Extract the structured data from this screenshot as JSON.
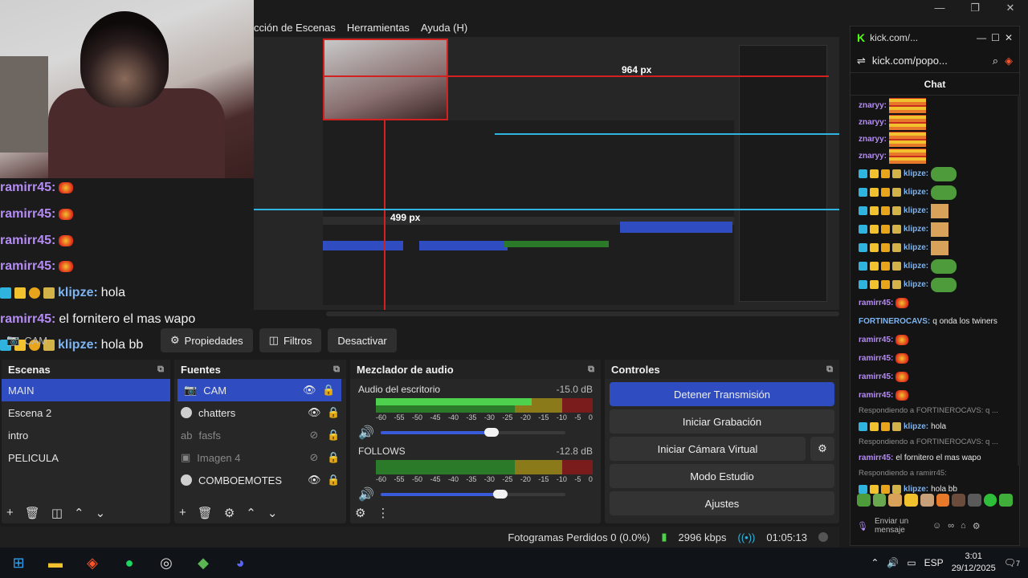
{
  "window": {
    "minimize": "—",
    "maximize": "❐",
    "close": "✕"
  },
  "menu": {
    "items": [
      "cción de Escenas",
      "Herramientas",
      "Ayuda (H)"
    ]
  },
  "preview": {
    "label_964": "964 px",
    "label_499": "499 px"
  },
  "chat_overlay": [
    {
      "user": "ramirr45:",
      "text": "",
      "type": "r"
    },
    {
      "user": "ramirr45:",
      "text": "",
      "type": "r"
    },
    {
      "user": "ramirr45:",
      "text": "",
      "type": "r"
    },
    {
      "user": "ramirr45:",
      "text": "",
      "type": "r"
    },
    {
      "user": "klipze:",
      "text": "hola",
      "type": "k"
    },
    {
      "user": "ramirr45:",
      "text": "el fornitero el mas wapo",
      "type": "r"
    },
    {
      "user": "klipze:",
      "text": "hola bb",
      "type": "k"
    }
  ],
  "toolbar": {
    "source": "CAM",
    "properties": "Propiedades",
    "filters": "Filtros",
    "deactivate": "Desactivar"
  },
  "scenes": {
    "title": "Escenas",
    "items": [
      "MAIN",
      "Escena 2",
      "intro",
      "PELICULA"
    ],
    "selected": 0
  },
  "sources": {
    "title": "Fuentes",
    "items": [
      {
        "name": "CAM",
        "visible": true
      },
      {
        "name": "chatters",
        "visible": true
      },
      {
        "name": "fasfs",
        "visible": false
      },
      {
        "name": "Imagen 4",
        "visible": false
      },
      {
        "name": "COMBOEMOTES",
        "visible": true
      }
    ],
    "selected": 0
  },
  "mixer": {
    "title": "Mezclador de audio",
    "tracks": [
      {
        "name": "Audio del escritorio",
        "db": "-15.0 dB",
        "level": 0.72,
        "volume": 0.6
      },
      {
        "name": "FOLLOWS",
        "db": "-12.8 dB",
        "level": 0.0,
        "volume": 0.65
      }
    ],
    "scale": [
      "-60",
      "-55",
      "-50",
      "-45",
      "-40",
      "-35",
      "-30",
      "-25",
      "-20",
      "-15",
      "-10",
      "-5",
      "0"
    ]
  },
  "controls": {
    "title": "Controles",
    "stop_stream": "Detener Transmisión",
    "start_recording": "Iniciar Grabación",
    "start_virtual_cam": "Iniciar Cámara Virtual",
    "studio_mode": "Modo Estudio",
    "settings": "Ajustes"
  },
  "status": {
    "dropped": "Fotogramas Perdidos 0 (0.0%)",
    "bitrate": "2996 kbps",
    "time": "01:05:13"
  },
  "kick": {
    "tab": "kick.com/...",
    "url": "kick.com/popo...",
    "chat_title": "Chat",
    "messages": [
      {
        "kind": "big",
        "user": "znaryy:",
        "cls": "r"
      },
      {
        "kind": "big",
        "user": "znaryy:",
        "cls": "r"
      },
      {
        "kind": "big",
        "user": "znaryy:",
        "cls": "r"
      },
      {
        "kind": "big",
        "user": "znaryy:",
        "cls": "r"
      },
      {
        "kind": "badge",
        "user": "klipze:",
        "cls": "k",
        "emote": "pepe"
      },
      {
        "kind": "badge",
        "user": "klipze:",
        "cls": "k",
        "emote": "pepe"
      },
      {
        "kind": "badge",
        "user": "klipze:",
        "cls": "k",
        "emote": "doge"
      },
      {
        "kind": "badge",
        "user": "klipze:",
        "cls": "k",
        "emote": "doge"
      },
      {
        "kind": "badge",
        "user": "klipze:",
        "cls": "k",
        "emote": "doge"
      },
      {
        "kind": "badge",
        "user": "klipze:",
        "cls": "k",
        "emote": "pepe"
      },
      {
        "kind": "badge",
        "user": "klipze:",
        "cls": "k",
        "emote": "pepe"
      },
      {
        "kind": "plain",
        "user": "ramirr45:",
        "cls": "r",
        "text": ""
      },
      {
        "kind": "plain",
        "user": "FORTINEROCAVS:",
        "cls": "f",
        "text": "q onda los twiners"
      },
      {
        "kind": "plain",
        "user": "ramirr45:",
        "cls": "r",
        "text": ""
      },
      {
        "kind": "plain",
        "user": "ramirr45:",
        "cls": "r",
        "text": ""
      },
      {
        "kind": "plain",
        "user": "ramirr45:",
        "cls": "r",
        "text": ""
      },
      {
        "kind": "plain",
        "user": "ramirr45:",
        "cls": "r",
        "text": ""
      }
    ],
    "replies": [
      {
        "reply": "Respondiendo a FORTINEROCAVS: q ...",
        "user": "klipze:",
        "cls": "k",
        "text": "hola"
      },
      {
        "reply": "Respondiendo a FORTINEROCAVS: q ...",
        "user": "ramirr45:",
        "cls": "r",
        "text": "el fornitero el mas wapo"
      },
      {
        "reply": "Respondiendo a ramirr45:",
        "user": "klipze:",
        "cls": "k",
        "text": "hola bb"
      }
    ],
    "input_placeholder": "Enviar un mensaje"
  },
  "taskbar": {
    "lang": "ESP",
    "time": "3:01",
    "date": "29/12/2025",
    "notif": "7"
  },
  "colors": {
    "accent": "#2f4dc1",
    "kick_green": "#53fc18",
    "red_guide": "#d3211f"
  }
}
